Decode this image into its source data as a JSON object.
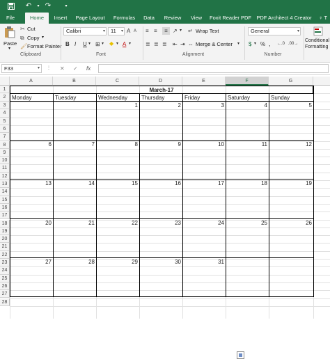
{
  "quick_access": {
    "save_icon": "save-icon",
    "undo_icon": "undo-icon",
    "redo_icon": "redo-icon",
    "customize_icon": "customize-icon"
  },
  "tabs": [
    "File",
    "Home",
    "Insert",
    "Page Layout",
    "Formulas",
    "Data",
    "Review",
    "View",
    "Foxit Reader PDF",
    "PDF Architect 4 Creator"
  ],
  "active_tab": "Home",
  "ribbon": {
    "clipboard": {
      "paste": "Paste",
      "cut": "Cut",
      "copy": "Copy",
      "format_painter": "Format Painter",
      "label": "Clipboard"
    },
    "font": {
      "name": "Calibri",
      "size": "11",
      "label": "Font",
      "bold": "B",
      "italic": "I",
      "underline": "U"
    },
    "alignment": {
      "wrap_text": "Wrap Text",
      "merge_center": "Merge & Center",
      "label": "Alignment"
    },
    "number": {
      "format": "General",
      "label": "Number"
    },
    "styles": {
      "conditional_line1": "Conditional",
      "conditional_line2": "Formatting"
    }
  },
  "formula_bar": {
    "name_box": "F33",
    "cancel_icon": "✕",
    "enter_icon": "✓",
    "fx": "fx",
    "value": ""
  },
  "columns": [
    "A",
    "B",
    "C",
    "D",
    "E",
    "F",
    "G"
  ],
  "selected_column": "F",
  "rows": [
    "1",
    "2",
    "3",
    "4",
    "5",
    "6",
    "7",
    "8",
    "9",
    "10",
    "11",
    "12",
    "13",
    "14",
    "15",
    "16",
    "17",
    "18",
    "19",
    "20",
    "21",
    "22",
    "23",
    "24",
    "25",
    "26",
    "27",
    "28"
  ],
  "calendar": {
    "title": "March-17",
    "days": [
      "Monday",
      "Tuesday",
      "Wednesday",
      "Thursday",
      "Friday",
      "Saturday",
      "Sunday"
    ],
    "weeks": [
      [
        "",
        "",
        "1",
        "2",
        "3",
        "4",
        "5"
      ],
      [
        "6",
        "7",
        "8",
        "9",
        "10",
        "11",
        "12"
      ],
      [
        "13",
        "14",
        "15",
        "16",
        "17",
        "18",
        "19"
      ],
      [
        "20",
        "21",
        "22",
        "23",
        "24",
        "25",
        "26"
      ],
      [
        "27",
        "28",
        "29",
        "30",
        "31",
        "",
        ""
      ]
    ]
  },
  "colors": {
    "excel_green": "#217346",
    "ribbon_bg": "#f3f3f3"
  }
}
